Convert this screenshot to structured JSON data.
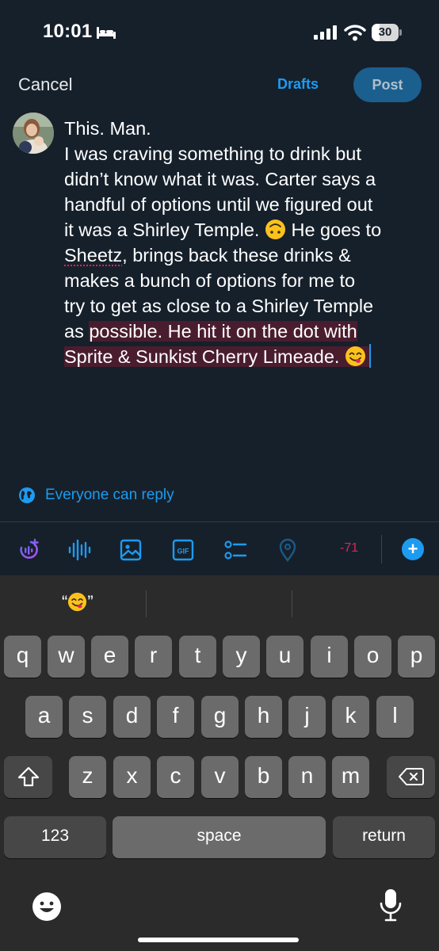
{
  "status_bar": {
    "time": "10:01",
    "battery": "30",
    "battery_level": 0.3
  },
  "header": {
    "cancel": "Cancel",
    "drafts": "Drafts",
    "post": "Post"
  },
  "compose": {
    "line1": "This. Man.",
    "line2": "I was craving something to drink but",
    "line3": "didn’t know what it was. Carter says a",
    "line4": "handful of options until we figured out",
    "line5": "it was a Shirley Temple. ",
    "line5_end": " He goes to",
    "line6_word": "Sheetz",
    "line6_rest": ", brings back these drinks &",
    "line7": "makes a bunch of options for me to",
    "line8": "try to get as close to a Shirley Temple",
    "line9_plain": "as ",
    "line9_selected": "possible. He hit it on the dot with",
    "line10": "Sprite & Sunkist Cherry Limeade. ",
    "emoji1": "upside-down-face",
    "emoji2": "face-savoring-food"
  },
  "reply_setting": "Everyone can reply",
  "toolbar": {
    "char_count": "-71",
    "icons": [
      "grok-icon",
      "voice-icon",
      "image-icon",
      "gif-icon",
      "poll-icon",
      "location-icon"
    ],
    "gif_label": "GIF",
    "plus": "+"
  },
  "keyboard": {
    "suggestion_open": "“",
    "suggestion_close": "”",
    "row1": [
      "q",
      "w",
      "e",
      "r",
      "t",
      "y",
      "u",
      "i",
      "o",
      "p"
    ],
    "row2": [
      "a",
      "s",
      "d",
      "f",
      "g",
      "h",
      "j",
      "k",
      "l"
    ],
    "row3": [
      "z",
      "x",
      "c",
      "v",
      "b",
      "n",
      "m"
    ],
    "numbers": "123",
    "space": "space",
    "return": "return"
  },
  "colors": {
    "accent": "#1d9bf0",
    "background": "#16202b",
    "selection": "#4a1d2e",
    "error": "#e0245e"
  }
}
